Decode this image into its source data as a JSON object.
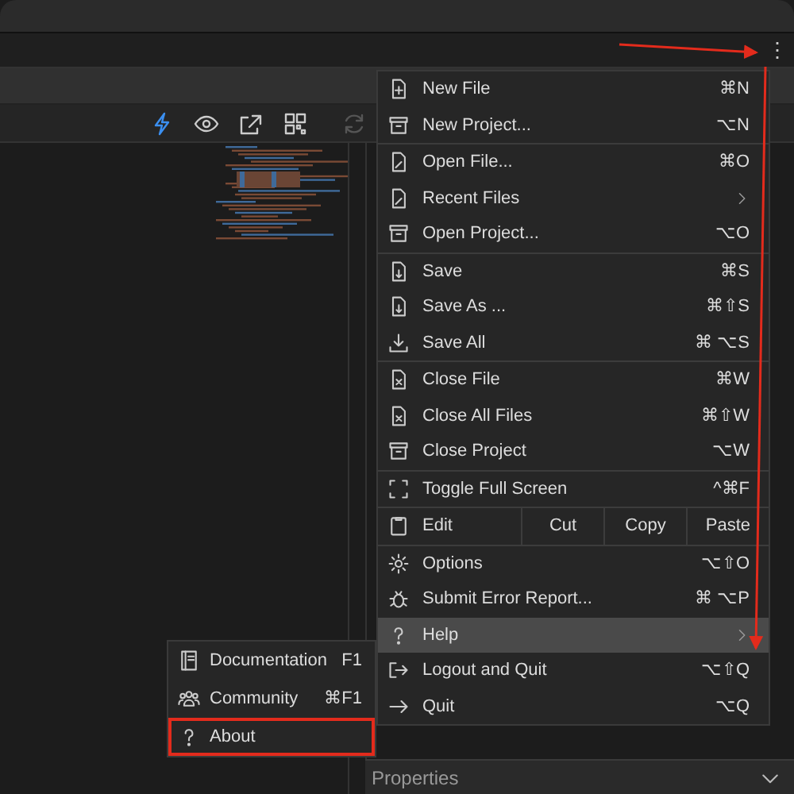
{
  "toolbar": [
    {
      "active": true,
      "disabled": false
    },
    {
      "active": false,
      "disabled": false
    },
    {
      "active": false,
      "disabled": false
    },
    {
      "active": false,
      "disabled": false
    },
    {
      "active": false,
      "disabled": true
    }
  ],
  "overflow_button": {
    "label": "⋮"
  },
  "menu": [
    {
      "kind": "item",
      "label": "New File",
      "shortcut": "⌘N",
      "selected": false
    },
    {
      "kind": "item",
      "label": "New Project...",
      "shortcut": "⌥N",
      "selected": false
    },
    {
      "kind": "separator"
    },
    {
      "kind": "item",
      "label": "Open File...",
      "shortcut": "⌘O",
      "selected": false
    },
    {
      "kind": "submenu",
      "label": "Recent Files",
      "selected": false
    },
    {
      "kind": "item",
      "label": "Open Project...",
      "shortcut": "⌥O",
      "selected": false
    },
    {
      "kind": "separator"
    },
    {
      "kind": "item",
      "label": "Save",
      "shortcut": "⌘S",
      "selected": false
    },
    {
      "kind": "item",
      "label": "Save As ...",
      "shortcut": "⌘⇧S",
      "selected": false
    },
    {
      "kind": "item",
      "label": "Save All",
      "shortcut": "⌘ ⌥S",
      "selected": false
    },
    {
      "kind": "separator"
    },
    {
      "kind": "item",
      "label": "Close File",
      "shortcut": "⌘W",
      "selected": false
    },
    {
      "kind": "item",
      "label": "Close All Files",
      "shortcut": "⌘⇧W",
      "selected": false
    },
    {
      "kind": "item",
      "label": "Close Project",
      "shortcut": "⌥W",
      "selected": false
    },
    {
      "kind": "separator"
    },
    {
      "kind": "item",
      "label": "Toggle Full Screen",
      "shortcut": "^⌘F",
      "selected": false
    },
    {
      "kind": "separator"
    },
    {
      "kind": "edit",
      "label": "Edit",
      "actions": [
        "Cut",
        "Copy",
        "Paste"
      ]
    },
    {
      "kind": "separator"
    },
    {
      "kind": "item",
      "label": "Options",
      "shortcut": "⌥⇧O",
      "selected": false
    },
    {
      "kind": "item",
      "label": "Submit Error Report...",
      "shortcut": "⌘ ⌥P",
      "selected": false
    },
    {
      "kind": "submenu",
      "label": "Help",
      "selected": true
    },
    {
      "kind": "item",
      "label": "Logout and Quit",
      "shortcut": "⌥⇧Q",
      "selected": false
    },
    {
      "kind": "item",
      "label": "Quit",
      "shortcut": "⌥Q",
      "selected": false
    }
  ],
  "help_submenu": [
    {
      "label": "Documentation",
      "shortcut": "F1",
      "outlined": false
    },
    {
      "label": "Community",
      "shortcut": "⌘F1",
      "outlined": false
    },
    {
      "label": "About",
      "outlined": true
    }
  ],
  "properties_panel": {
    "title": "Properties"
  }
}
